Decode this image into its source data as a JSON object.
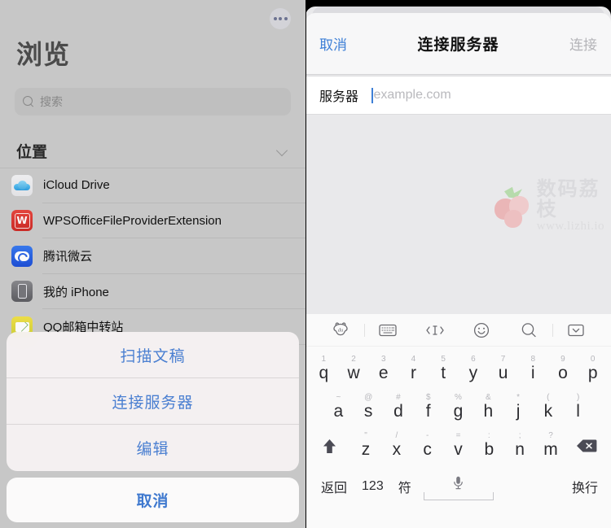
{
  "left": {
    "more_button": "more-icon",
    "title": "浏览",
    "search": {
      "placeholder": "搜索",
      "icon": "search-icon"
    },
    "locations_header": "位置",
    "locations_chevron": "chevron-down-icon",
    "locations": [
      {
        "label": "iCloud Drive",
        "icon": "icloud-icon"
      },
      {
        "label": "WPSOfficeFileProviderExtension",
        "icon": "wps-icon"
      },
      {
        "label": "腾讯微云",
        "icon": "weiyun-icon"
      },
      {
        "label": "我的 iPhone",
        "icon": "iphone-icon"
      },
      {
        "label": "QQ邮箱中转站",
        "icon": "qqmail-icon"
      }
    ]
  },
  "action_sheet": {
    "items": [
      "扫描文稿",
      "连接服务器",
      "编辑"
    ],
    "cancel": "取消",
    "accent_color": "#4a7fd1"
  },
  "right": {
    "nav": {
      "cancel": "取消",
      "title": "连接服务器",
      "connect": "连接",
      "cancel_color": "#3d7fd6",
      "connect_color": "#b4b4b8"
    },
    "form": {
      "label": "服务器",
      "value": "",
      "placeholder": "example.com"
    },
    "watermark": {
      "name": "数码荔枝",
      "url": "www.lizhi.io"
    }
  },
  "keyboard": {
    "toolbar": [
      "baidu-logo-icon",
      "keyboard-switch-icon",
      "cursor-move-icon",
      "emoji-icon",
      "search-icon",
      "dismiss-keyboard-icon"
    ],
    "row1": [
      {
        "main": "q",
        "sub": "1"
      },
      {
        "main": "w",
        "sub": "2"
      },
      {
        "main": "e",
        "sub": "3"
      },
      {
        "main": "r",
        "sub": "4"
      },
      {
        "main": "t",
        "sub": "5"
      },
      {
        "main": "y",
        "sub": "6"
      },
      {
        "main": "u",
        "sub": "7"
      },
      {
        "main": "i",
        "sub": "8"
      },
      {
        "main": "o",
        "sub": "9"
      },
      {
        "main": "p",
        "sub": "0"
      }
    ],
    "row2": [
      {
        "main": "a",
        "sub": "~"
      },
      {
        "main": "s",
        "sub": "@"
      },
      {
        "main": "d",
        "sub": "#"
      },
      {
        "main": "f",
        "sub": "$"
      },
      {
        "main": "g",
        "sub": "%"
      },
      {
        "main": "h",
        "sub": "&"
      },
      {
        "main": "j",
        "sub": "*"
      },
      {
        "main": "k",
        "sub": "("
      },
      {
        "main": "l",
        "sub": ")"
      }
    ],
    "row3": [
      {
        "main": "z",
        "sub": "\""
      },
      {
        "main": "x",
        "sub": "/"
      },
      {
        "main": "c",
        "sub": "-"
      },
      {
        "main": "v",
        "sub": "="
      },
      {
        "main": "b",
        "sub": ":"
      },
      {
        "main": "n",
        "sub": ";"
      },
      {
        "main": "m",
        "sub": "?"
      }
    ],
    "shift": "shift-icon",
    "delete": "delete-icon",
    "bottom": {
      "back": "返回",
      "numbers": "123",
      "symbols": "符",
      "mic": "microphone-icon",
      "space": "space-bar",
      "return": "换行"
    }
  }
}
